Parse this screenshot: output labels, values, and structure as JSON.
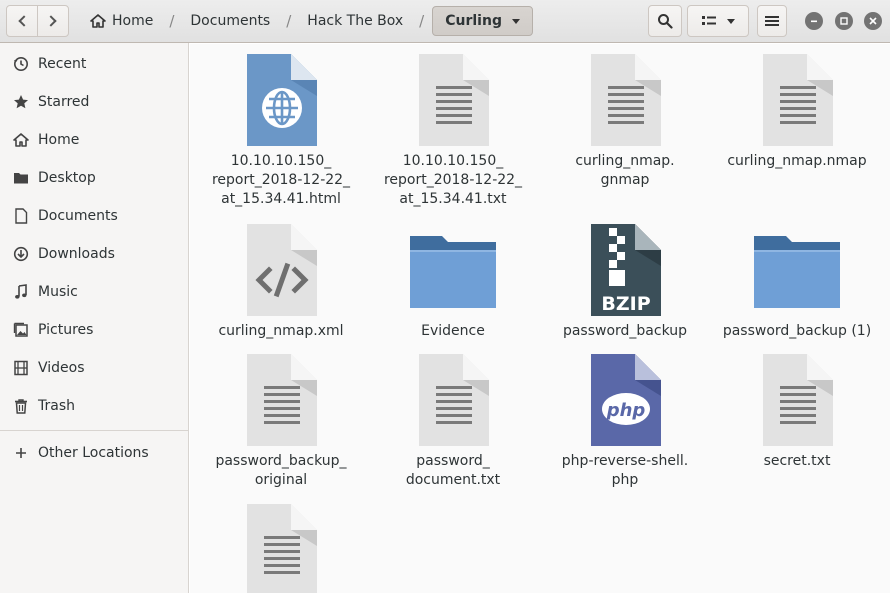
{
  "header": {
    "breadcrumbs": [
      "Home",
      "Documents",
      "Hack The Box"
    ],
    "current_folder": "Curling",
    "icons": {
      "back": "chevron-left-icon",
      "forward": "chevron-right-icon",
      "home": "home-icon",
      "search": "search-icon",
      "view": "list-view-icon",
      "menu": "hamburger-menu-icon",
      "minimize": "minimize-icon",
      "maximize": "maximize-icon",
      "close": "close-icon"
    }
  },
  "sidebar": {
    "items": [
      {
        "label": "Recent",
        "icon": "clock-icon"
      },
      {
        "label": "Starred",
        "icon": "star-icon"
      },
      {
        "label": "Home",
        "icon": "home-icon"
      },
      {
        "label": "Desktop",
        "icon": "folder-icon"
      },
      {
        "label": "Documents",
        "icon": "document-icon"
      },
      {
        "label": "Downloads",
        "icon": "download-icon"
      },
      {
        "label": "Music",
        "icon": "music-icon"
      },
      {
        "label": "Pictures",
        "icon": "picture-icon"
      },
      {
        "label": "Videos",
        "icon": "video-icon"
      },
      {
        "label": "Trash",
        "icon": "trash-icon"
      }
    ],
    "other_locations": "Other Locations"
  },
  "files": [
    {
      "name": "10.10.10.150_\nreport_2018-12-22_\nat_15.34.41.html",
      "type": "html"
    },
    {
      "name": "10.10.10.150_\nreport_2018-12-22_\nat_15.34.41.txt",
      "type": "text"
    },
    {
      "name": "curling_nmap.\ngnmap",
      "type": "text"
    },
    {
      "name": "curling_nmap.nmap",
      "type": "text"
    },
    {
      "name": "curling_nmap.xml",
      "type": "xml"
    },
    {
      "name": "Evidence",
      "type": "folder"
    },
    {
      "name": "password_backup",
      "type": "bzip"
    },
    {
      "name": "password_backup (1)",
      "type": "folder"
    },
    {
      "name": "password_backup_\noriginal",
      "type": "text"
    },
    {
      "name": "password_\ndocument.txt",
      "type": "text"
    },
    {
      "name": "php-reverse-shell.\nphp",
      "type": "php"
    },
    {
      "name": "secret.txt",
      "type": "text"
    },
    {
      "name": "",
      "type": "text"
    }
  ],
  "icon_labels": {
    "bzip": "BZIP",
    "php": "php"
  },
  "colors": {
    "folder_front": "#6f9fd6",
    "folder_back": "#3f6d9e",
    "html_blue": "#6b97c7",
    "bzip_dark": "#3b4f59",
    "php_purple": "#5a68a8",
    "doc_gray": "#e2e2e2"
  }
}
